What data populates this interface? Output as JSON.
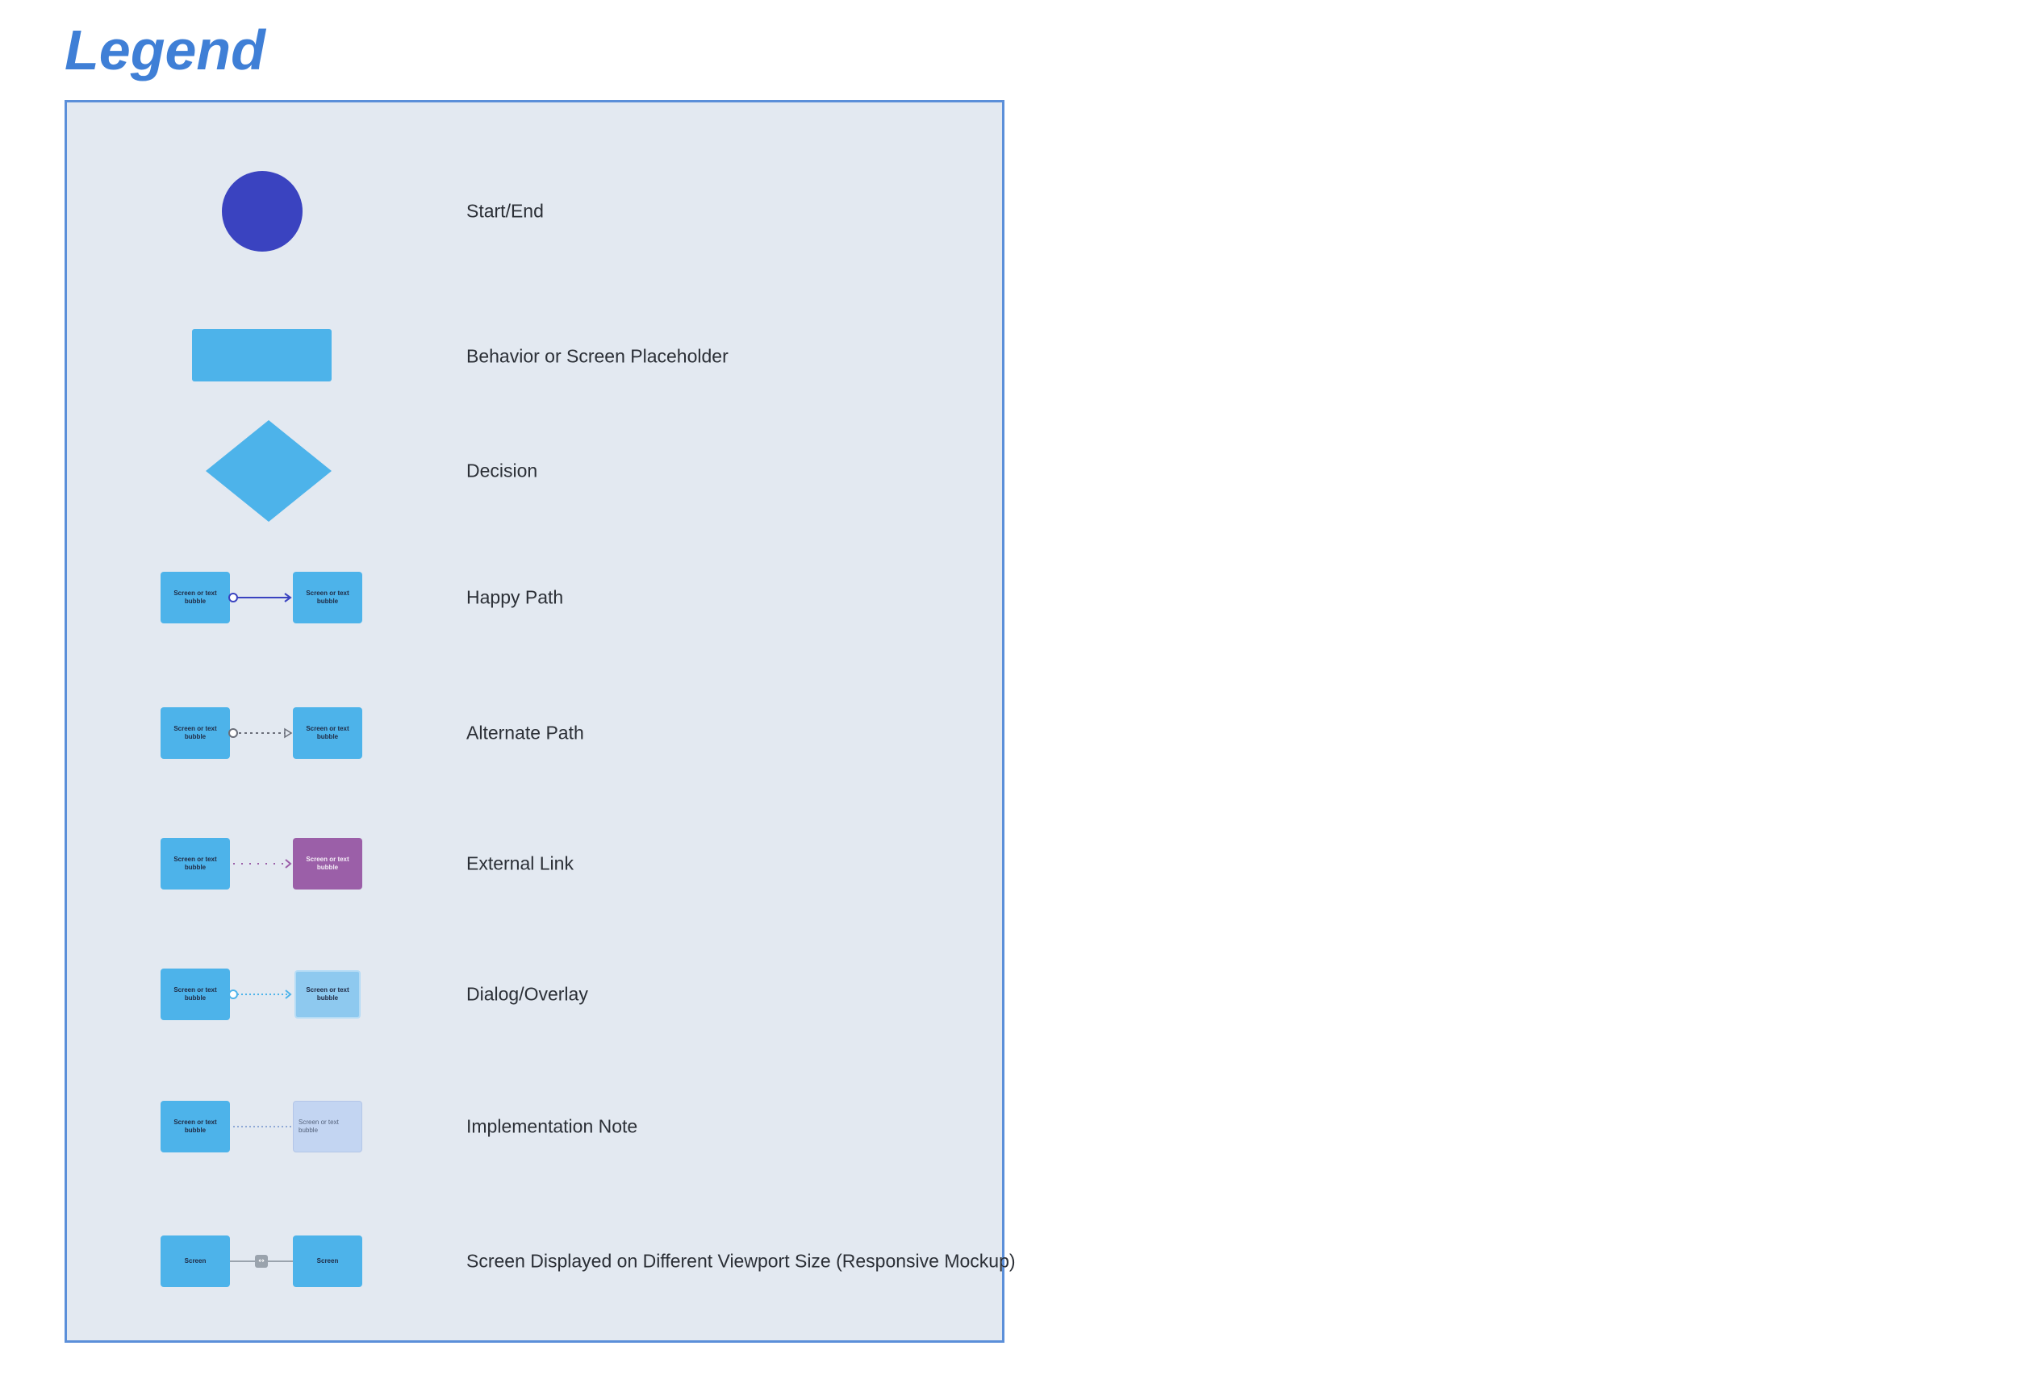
{
  "legend": {
    "title": "Legend",
    "items": {
      "start_end": {
        "label": "Start/End",
        "color": "#3a43c0"
      },
      "behavior": {
        "label": "Behavior or Screen Placeholder",
        "color": "#4db3ea"
      },
      "decision": {
        "label": "Decision",
        "color": "#4db3ea"
      },
      "happy_path": {
        "label": "Happy Path",
        "from_text": "Screen or text bubble",
        "to_text": "Screen or text bubble",
        "line_color": "#3a43c0"
      },
      "alternate_path": {
        "label": "Alternate Path",
        "from_text": "Screen or text bubble",
        "to_text": "Screen or text bubble",
        "line_color": "#6b6f7a"
      },
      "external_link": {
        "label": "External Link",
        "from_text": "Screen or text bubble",
        "to_text": "Screen or text bubble",
        "target_color": "#9b5fa8",
        "line_color": "#9b5fa8"
      },
      "dialog_overlay": {
        "label": "Dialog/Overlay",
        "from_text": "Screen or text bubble",
        "to_text": "Screen or text bubble",
        "target_color": "#8ec9ef",
        "line_color": "#4db3ea"
      },
      "implementation_note": {
        "label": "Implementation Note",
        "from_text": "Screen or text bubble",
        "to_text": "Screen or text bubble",
        "target_color": "#c3d5f2",
        "line_color": "#8fa9d6"
      },
      "responsive": {
        "label": "Screen Displayed on Different Viewport Size (Responsive Mockup)",
        "from_text": "Screen",
        "to_text": "Screen",
        "badge_icon": "link-icon",
        "line_color": "#9aa3ad"
      }
    },
    "colors": {
      "panel_bg": "#e3e9f1",
      "panel_border": "#5b8fd9",
      "title": "#3f7fd6",
      "box_blue": "#4db3ea"
    }
  }
}
